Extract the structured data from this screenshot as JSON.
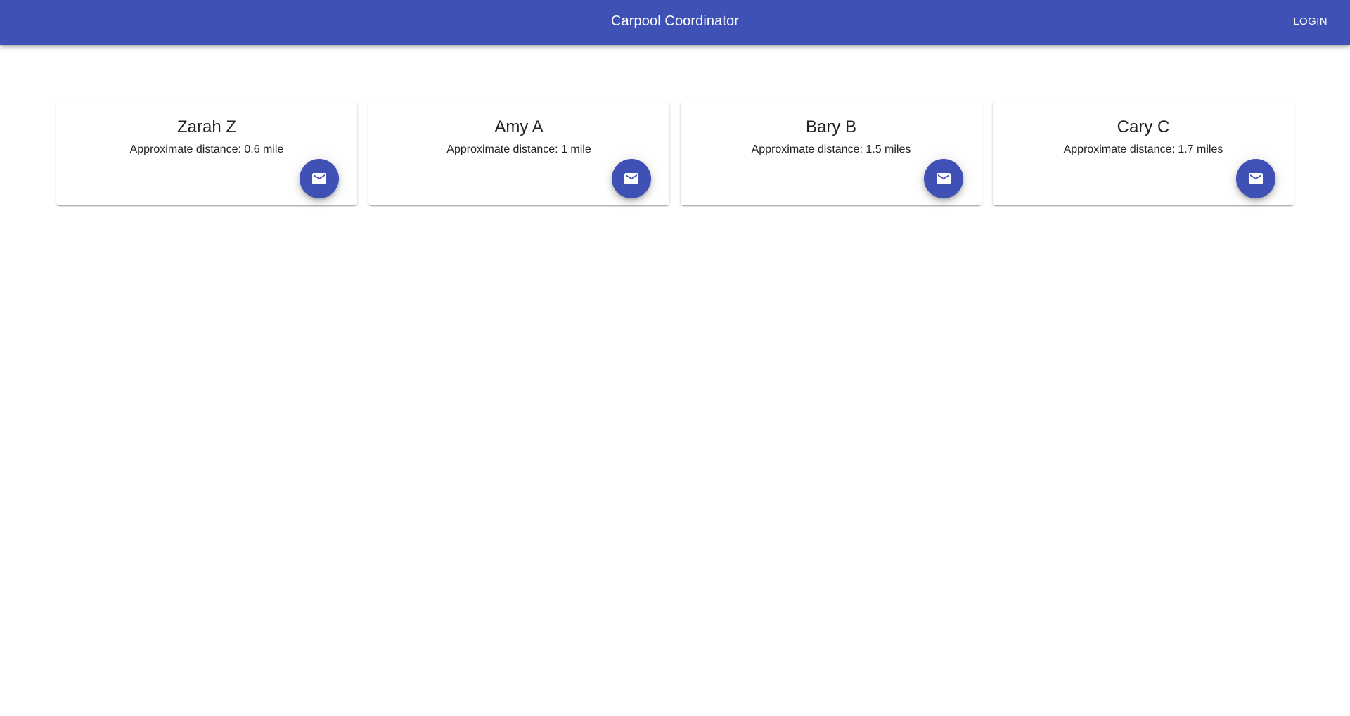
{
  "header": {
    "title": "Carpool Coordinator",
    "login_label": "LOGIN"
  },
  "colors": {
    "primary": "#3f51b5",
    "background": "#ffffff",
    "text": "#212121"
  },
  "cards": [
    {
      "name": "Zarah Z",
      "distance": "Approximate distance: 0.6 mile",
      "action_icon": "mail-icon"
    },
    {
      "name": "Amy A",
      "distance": "Approximate distance: 1 mile",
      "action_icon": "mail-icon"
    },
    {
      "name": "Bary B",
      "distance": "Approximate distance: 1.5 miles",
      "action_icon": "mail-icon"
    },
    {
      "name": "Cary C",
      "distance": "Approximate distance: 1.7 miles",
      "action_icon": "mail-icon"
    }
  ]
}
